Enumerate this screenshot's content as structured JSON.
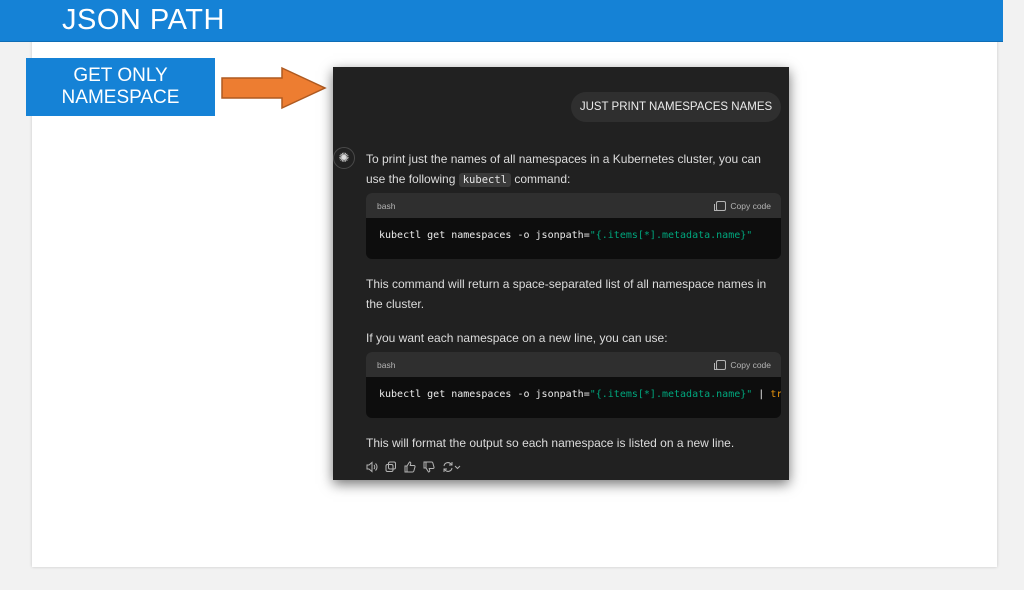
{
  "header": {
    "title": "JSON PATH"
  },
  "label": {
    "line1": "GET ONLY",
    "line2": "NAMESPACE"
  },
  "chat": {
    "user_message": "JUST PRINT NAMESPACES NAMES",
    "intro_before": "To print just the names of all namespaces in a Kubernetes cluster, you can use the following ",
    "intro_code": "kubectl",
    "intro_after": " command:",
    "code1": {
      "lang": "bash",
      "copy_label": "Copy code",
      "cmd": "kubectl get namespaces -o jsonpath=",
      "arg": "\"{.items[*].metadata.name}\""
    },
    "para2": "This command will return a space-separated list of all namespace names in the cluster.",
    "para3": "If you want each namespace on a new line, you can use:",
    "code2": {
      "lang": "bash",
      "copy_label": "Copy code",
      "cmd": "kubectl get namespaces -o jsonpath=",
      "arg": "\"{.items[*].metadata.name}\"",
      "pipe": " | ",
      "tr": "tr"
    },
    "para4": "This will format the output so each namespace is listed on a new line.",
    "actions": [
      "read-aloud-icon",
      "copy-icon",
      "thumbs-up-icon",
      "thumbs-down-icon",
      "regenerate-icon"
    ]
  },
  "colors": {
    "header_blue": "#1582d6",
    "arrow_orange": "#ed7d31",
    "chat_bg": "#212121",
    "string_green": "#00a67d",
    "keyword_orange": "#e9950c"
  }
}
